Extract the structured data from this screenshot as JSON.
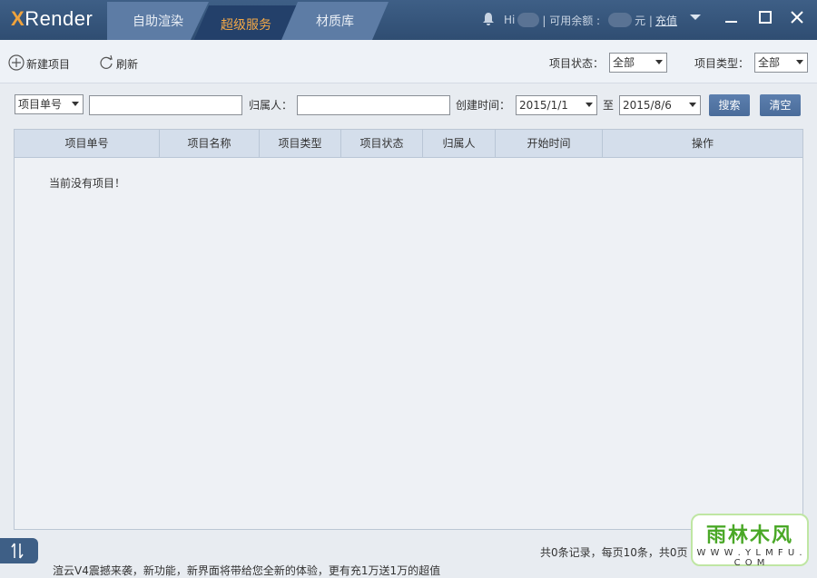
{
  "app": {
    "logo_x": "X",
    "logo_rest": "Render"
  },
  "tabs": [
    {
      "label": "自助渲染",
      "active": false
    },
    {
      "label": "超级服务",
      "active": true
    },
    {
      "label": "材质库",
      "active": false
    }
  ],
  "account": {
    "greeting": "Hi",
    "balance_label": "| 可用余额 :",
    "currency": "元 |",
    "recharge": "充值"
  },
  "toolbar": {
    "new_project": "新建项目",
    "refresh": "刷新",
    "status_label": "项目状态：",
    "status_value": "全部",
    "type_label": "项目类型：",
    "type_value": "全部"
  },
  "filter": {
    "field_select": "项目单号",
    "owner_label": "归属人：",
    "created_label": "创建时间：",
    "date_from": "2015/1/1",
    "to_label": "至",
    "date_to": "2015/8/6",
    "search": "搜索",
    "clear": "清空"
  },
  "table": {
    "columns": [
      "项目单号",
      "项目名称",
      "项目类型",
      "项目状态",
      "归属人",
      "开始时间",
      "操作"
    ],
    "empty_text": "当前没有项目！"
  },
  "footer": {
    "paging": "共0条记录，每页10条，共0页",
    "ticker": "渲云V4震撼来袭，新功能，新界面将带给您全新的体验，更有充1万送1万的超值"
  },
  "watermark": {
    "big": "雨林木风",
    "small": "W W W . Y L M F U . C O M"
  },
  "colors": {
    "titlebar": "#2f4d72",
    "accent": "#f3a847",
    "button": "#4a6c9a"
  }
}
